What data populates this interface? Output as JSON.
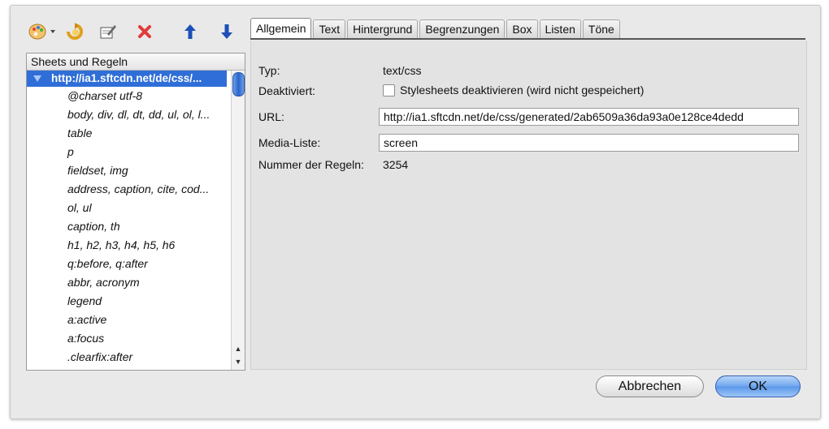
{
  "toolbar": {
    "icons": [
      "palette-icon",
      "import-icon",
      "edit-icon",
      "delete-icon",
      "move-up-icon",
      "move-down-icon"
    ]
  },
  "tree": {
    "header": "Sheets und Regeln",
    "root": "http://ia1.sftcdn.net/de/css/...",
    "items": [
      "@charset utf-8",
      "body, div, dl, dt, dd, ul, ol, l...",
      "table",
      "p",
      "fieldset, img",
      "address, caption, cite, cod...",
      "ol, ul",
      "caption, th",
      "h1, h2, h3, h4, h5, h6",
      "q:before, q:after",
      "abbr, acronym",
      "legend",
      "a:active",
      "a:focus",
      ".clearfix:after"
    ]
  },
  "tabs": [
    "Allgemein",
    "Text",
    "Hintergrund",
    "Begrenzungen",
    "Box",
    "Listen",
    "Töne"
  ],
  "form": {
    "type_label": "Typ:",
    "type_value": "text/css",
    "disabled_label": "Deaktiviert:",
    "disabled_checkbox_label": "Stylesheets deaktivieren (wird nicht gespeichert)",
    "url_label": "URL:",
    "url_value": "http://ia1.sftcdn.net/de/css/generated/2ab6509a36da93a0e128ce4dedd",
    "media_label": "Media-Liste:",
    "media_value": "screen",
    "rules_label": "Nummer der Regeln:",
    "rules_value": "3254"
  },
  "buttons": {
    "cancel": "Abbrechen",
    "ok": "OK"
  }
}
